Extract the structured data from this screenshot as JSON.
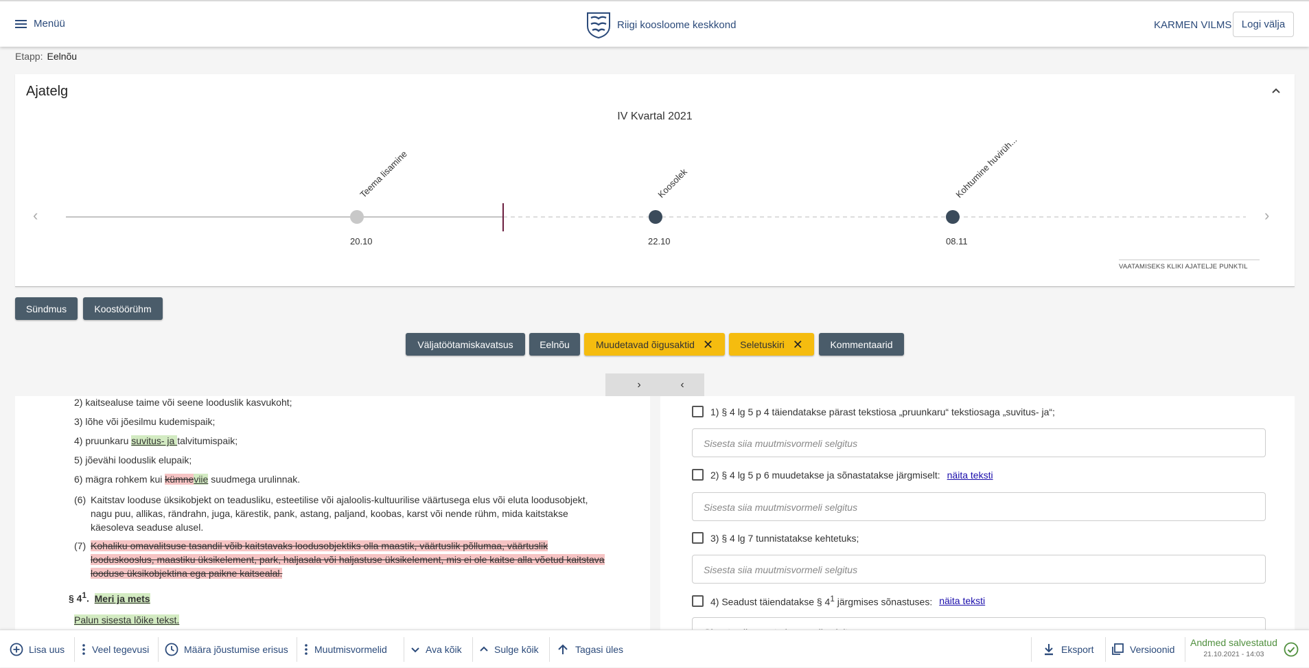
{
  "header": {
    "menu_label": "Menüü",
    "brand": "Riigi koosloome keskkond",
    "user": "KARMEN VILMS",
    "logout": "Logi välja"
  },
  "stage": {
    "label": "Etapp:",
    "value": "Eelnõu"
  },
  "timeline": {
    "title": "Ajatelg",
    "quarter": "IV Kvartal 2021",
    "hint": "VAATAMISEKS KLIKI AJATELJE PUNKTIL",
    "events": [
      {
        "label": "Teema lisamine",
        "date": "20.10",
        "status": "past"
      },
      {
        "label": "Koosolek",
        "date": "22.10",
        "status": "future"
      },
      {
        "label": "Kohtumine huvirüh...",
        "date": "08.11",
        "status": "future"
      }
    ]
  },
  "actions": {
    "event": "Sündmus",
    "working_group": "Koostöörühm"
  },
  "filters": [
    {
      "label": "Väljatöötamiskavatsus",
      "active": false
    },
    {
      "label": "Eelnõu",
      "active": false
    },
    {
      "label": "Muudetavad õigusaktid",
      "active": true
    },
    {
      "label": "Seletuskiri",
      "active": true
    },
    {
      "label": "Kommentaarid",
      "active": false
    }
  ],
  "left_doc": {
    "p1": {
      "num": "2)",
      "text": "kaitsealuse taime või seene looduslik kasvukoht;"
    },
    "p2": {
      "num": "3)",
      "text": "lõhe või jõesilmu kudemispaik;"
    },
    "p3": {
      "num": "4)",
      "pre": "pruunkaru ",
      "ins": "suvitus- ja ",
      "post": "talvitumispaik;"
    },
    "p4": {
      "num": "5)",
      "text": "jõevähi looduslik elupaik;"
    },
    "p5": {
      "num": "6)",
      "pre": "mägra rohkem kui ",
      "del": "kümne",
      "ins": "viie",
      "post": " suudmega urulinnak."
    },
    "p6": {
      "num": "(6)",
      "text": "Kaitstav looduse üksikobjekt on teadusliku, esteetilise või ajaloolis-kultuurilise väärtusega elus või eluta loodusobjekt, nagu puu, allikas, rändrahn, juga, kärestik, pank, astang, paljand, koobas, karst või nende rühm, mida kaitstakse käesoleva seaduse alusel."
    },
    "p7": {
      "num": "(7)",
      "del": "Kohaliku omavalitsuse tasandil võib kaitstavaks loodusobjektiks olla maastik, väärtuslik põllumaa, väärtuslik looduskooslus, maastiku üksikelement, park, haljasala või haljastuse üksikelement, mis ei ole kaitse alla võetud kaitstava looduse üksikobjektina ega paikne kaitsealal."
    },
    "section": {
      "prefix": "§ 4",
      "sup": "1",
      "dot": ".",
      "title": "Meri ja mets"
    },
    "prompt": "Palun sisesta lõike tekst."
  },
  "right_doc": {
    "placeholder": "Sisesta siia muutmisvormeli selgitus",
    "items": [
      {
        "text": "1)  § 4 lg 5 p 4 täiendatakse pärast tekstiosa „pruunkaru“ tekstiosaga  „suvitus- ja“;",
        "link": ""
      },
      {
        "text": "2)  § 4 lg 5 p 6 muudetakse ja sõnastatakse järgmiselt:",
        "link": "näita teksti"
      },
      {
        "text": "3)  § 4 lg 7 tunnistatakse kehtetuks;",
        "link": ""
      },
      {
        "text_pre": "4)  Seadust täiendatakse § 4",
        "sup": "1",
        "text_post": " järgmises sõnastuses:",
        "link": "näita teksti"
      }
    ]
  },
  "bottom": {
    "add": "Lisa uus",
    "more": "Veel tegevusi",
    "effective": "Määra jõustumise erisus",
    "forms": "Muutmisvormelid",
    "open_all": "Ava kõik",
    "close_all": "Sulge kõik",
    "back_up": "Tagasi üles",
    "export": "Eksport",
    "versions": "Versioonid",
    "saved": "Andmed salvestatud",
    "saved_time": "21.10.2021 - 14:03"
  },
  "colors": {
    "accent": "#2b4a7a",
    "dark_button": "#4a5c6a",
    "active_filter": "#f5bc0f",
    "insert": "#d3ebc2",
    "delete": "#f6c4c4"
  }
}
